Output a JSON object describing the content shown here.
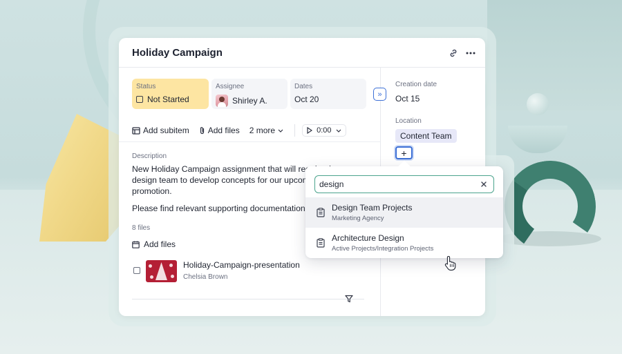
{
  "card": {
    "title": "Holiday Campaign",
    "header_icons": [
      "link-icon",
      "more-horizontal-icon"
    ]
  },
  "fields": {
    "status": {
      "label": "Status",
      "value": "Not Started",
      "color": "#fde5a2"
    },
    "assignee": {
      "label": "Assignee",
      "value": "Shirley A."
    },
    "dates": {
      "label": "Dates",
      "value": "Oct 20"
    }
  },
  "toolbar": {
    "add_subitem": "Add subitem",
    "add_files": "Add files",
    "more": "2 more",
    "timer": "0:00"
  },
  "description": {
    "label": "Description",
    "paragraph1": "New Holiday Campaign assignment that will require the design team to develop concepts for our upcoming promotion.",
    "paragraph2": "Please find relevant supporting documentation below."
  },
  "files": {
    "count_label": "8 files",
    "add_label": "Add files",
    "items": [
      {
        "name": "Holiday-Campaign-presentation",
        "owner": "Chelsia Brown"
      }
    ]
  },
  "sidebar": {
    "creation_label": "Creation date",
    "creation_value": "Oct 15",
    "location_label": "Location",
    "location_tag": "Content Team"
  },
  "popover": {
    "search_value": "design",
    "results": [
      {
        "title": "Design Team Projects",
        "subtitle": "Marketing Agency"
      },
      {
        "title": "Architecture Design",
        "subtitle": "Active Projects/Integration Projects"
      }
    ]
  },
  "colors": {
    "accent": "#3c6fd6",
    "search_border": "#4aa38c",
    "status_bg": "#fde5a2",
    "tag_bg": "#e7e8f8"
  }
}
